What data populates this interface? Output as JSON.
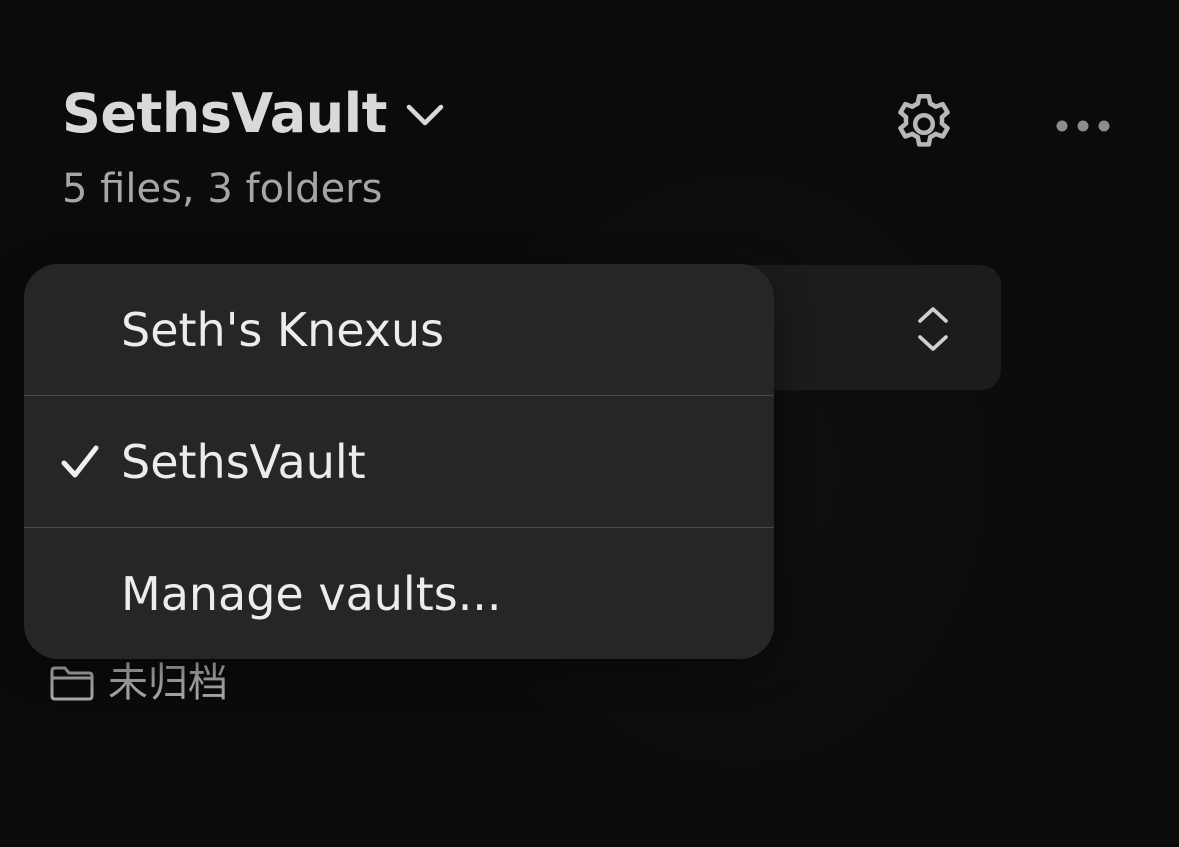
{
  "header": {
    "vault_name": "SethsVault",
    "stats": "5 files, 3 folders"
  },
  "icons": {
    "vault_switch": "chevron-down-icon",
    "settings": "gear-icon",
    "more": "more-horizontal-icon",
    "sort": "up-down-chevrons-icon",
    "folder": "folder-icon",
    "selected": "checkmark-icon"
  },
  "vault_menu": {
    "items": [
      {
        "label": "Seth's Knexus",
        "selected": false
      },
      {
        "label": "SethsVault",
        "selected": true
      },
      {
        "label": "Manage vaults...",
        "selected": false
      }
    ]
  },
  "tree": {
    "folders": [
      {
        "label": "未归档"
      }
    ]
  },
  "colors": {
    "background": "#0b0b0b",
    "menu_background": "#262626",
    "sort_bar_background": "#1c1c1c",
    "primary_text": "#ececec",
    "secondary_text": "#a6a6a6",
    "divider": "#4a4a4a"
  }
}
